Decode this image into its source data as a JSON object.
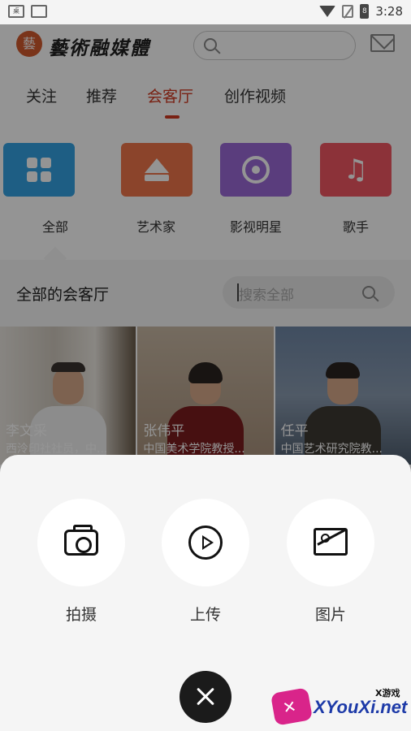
{
  "status_bar": {
    "time": "3:28",
    "battery_glyph": "8",
    "left_icons": [
      "notification-icon",
      "image-icon"
    ],
    "right_icons": [
      "wifi-icon",
      "no-sim-icon",
      "battery-icon"
    ]
  },
  "header": {
    "logo_seal": "藝",
    "logo_text": "藝術融媒體",
    "search_icon": "search-icon",
    "mail_icon": "mail-icon"
  },
  "tabs": [
    {
      "label": "关注",
      "active": false
    },
    {
      "label": "推荐",
      "active": false
    },
    {
      "label": "会客厅",
      "active": true
    },
    {
      "label": "创作视频",
      "active": false
    }
  ],
  "categories": [
    {
      "label": "全部",
      "icon": "grid-icon",
      "color": "#34a3e3"
    },
    {
      "label": "艺术家",
      "icon": "crown-icon",
      "color": "#f0764a"
    },
    {
      "label": "影视明星",
      "icon": "film-reel-icon",
      "color": "#9b6ad8"
    },
    {
      "label": "歌手",
      "icon": "music-note-icon",
      "color": "#f25663"
    }
  ],
  "section": {
    "title": "全部的会客厅",
    "search_placeholder": "搜索全部"
  },
  "hosts": [
    {
      "name": "李文采",
      "desc": "西泠印社社员，中..."
    },
    {
      "name": "张伟平",
      "desc": "中国美术学院教授..."
    },
    {
      "name": "任平",
      "desc": "中国艺术研究院教..."
    }
  ],
  "sheet": {
    "actions": [
      {
        "label": "拍摄",
        "icon": "camera-icon"
      },
      {
        "label": "上传",
        "icon": "play-circle-icon"
      },
      {
        "label": "图片",
        "icon": "image-icon"
      }
    ],
    "close_icon": "close-icon"
  },
  "watermark": {
    "small": "X游戏",
    "main": "XYouXi.net"
  }
}
